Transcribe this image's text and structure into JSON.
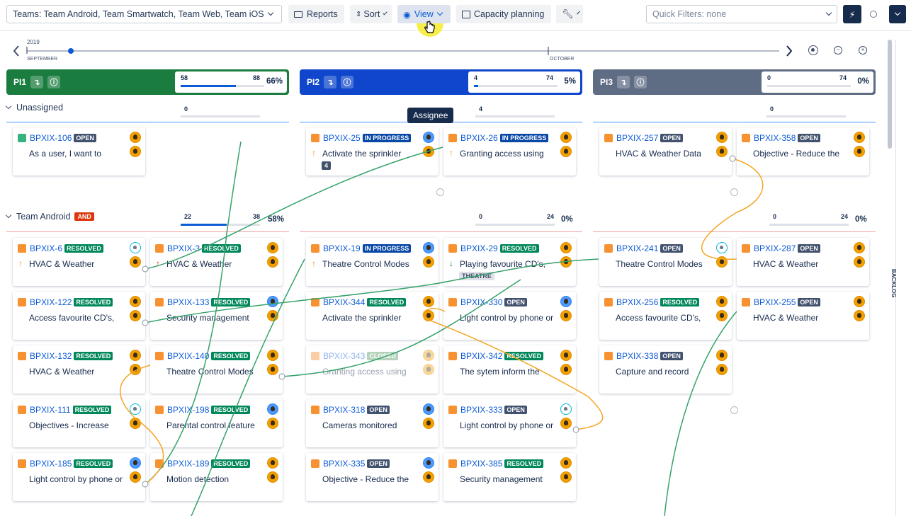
{
  "toolbar": {
    "teams": "Teams: Team Android, Team Smartwatch, Team Web, Team iOS",
    "reports": "Reports",
    "sort": "Sort",
    "view": "View",
    "capacity": "Capacity planning",
    "quick_filters": "Quick Filters: none"
  },
  "timeline": {
    "year": "2019",
    "month1": "SEPTEMBER",
    "month2": "OCTOBER"
  },
  "pis": [
    {
      "name": "PI1",
      "done": "58",
      "total": "88",
      "pct": "66%",
      "fill": 0.66,
      "color": "#1b7c3f",
      "accent": "#0c5bd6"
    },
    {
      "name": "PI2",
      "done": "4",
      "total": "74",
      "pct": "5%",
      "fill": 0.05,
      "color": "#0f46cc",
      "accent": "#0c5bd6"
    },
    {
      "name": "PI3",
      "done": "0",
      "total": "74",
      "pct": "0%",
      "fill": 0,
      "color": "#5e6c84",
      "accent": "#0c5bd6"
    }
  ],
  "lanes": [
    {
      "label": "Unassigned",
      "badge": "",
      "pi1": "0",
      "pi2": "4",
      "pi3": "0"
    },
    {
      "label": "Team Android",
      "badge": "AND",
      "pi1_done": "22",
      "pi1_total": "38",
      "pi1_pct": "58%",
      "pi2_done": "0",
      "pi2_total": "24",
      "pi2_pct": "0%",
      "pi3_done": "0",
      "pi3_total": "24",
      "pi3_pct": "0%"
    }
  ],
  "tooltip": "Assignee",
  "backlog": "BACKLOG",
  "cards": [
    {
      "key": "BPXIX-106",
      "status": "OPEN",
      "title": "As a user, I want to",
      "type": "story"
    },
    {
      "key": "BPXIX-25",
      "status": "IN PROGRESS",
      "title": "Activate the sprinkler",
      "num": "4"
    },
    {
      "key": "BPXIX-26",
      "status": "IN PROGRESS",
      "title": "Granting access using"
    },
    {
      "key": "BPXIX-257",
      "status": "OPEN",
      "title": "HVAC & Weather Data"
    },
    {
      "key": "BPXIX-358",
      "status": "OPEN",
      "title": "Objective - Reduce the"
    },
    {
      "key": "BPXIX-6",
      "status": "RESOLVED",
      "title": "HVAC & Weather"
    },
    {
      "key": "BPXIX-3",
      "status": "RESOLVED",
      "title": "HVAC & Weather"
    },
    {
      "key": "BPXIX-19",
      "status": "IN PROGRESS",
      "title": "Theatre Control Modes"
    },
    {
      "key": "BPXIX-29",
      "status": "RESOLVED",
      "title": "Playing favourite CD's,",
      "chip": "THEATRE"
    },
    {
      "key": "BPXIX-241",
      "status": "OPEN",
      "title": "Theatre Control Modes"
    },
    {
      "key": "BPXIX-287",
      "status": "OPEN",
      "title": "HVAC & Weather"
    },
    {
      "key": "BPXIX-122",
      "status": "RESOLVED",
      "title": "Access favourite CD's,"
    },
    {
      "key": "BPXIX-133",
      "status": "RESOLVED",
      "title": "Security management"
    },
    {
      "key": "BPXIX-344",
      "status": "RESOLVED",
      "title": "Activate the sprinkler"
    },
    {
      "key": "BPXIX-330",
      "status": "OPEN",
      "title": "Light control by phone or"
    },
    {
      "key": "BPXIX-256",
      "status": "RESOLVED",
      "title": "Access favourite CD's,"
    },
    {
      "key": "BPXIX-255",
      "status": "OPEN",
      "title": "HVAC & Weather"
    },
    {
      "key": "BPXIX-132",
      "status": "RESOLVED",
      "title": "HVAC & Weather"
    },
    {
      "key": "BPXIX-140",
      "status": "RESOLVED",
      "title": "Theatre Control Modes"
    },
    {
      "key": "BPXIX-343",
      "status": "CLOSED",
      "title": "Granting access using"
    },
    {
      "key": "BPXIX-342",
      "status": "RESOLVED",
      "title": "The sytem inform the"
    },
    {
      "key": "BPXIX-338",
      "status": "OPEN",
      "title": "Capture and record"
    },
    {
      "key": "BPXIX-111",
      "status": "RESOLVED",
      "title": "Objectives - Increase"
    },
    {
      "key": "BPXIX-198",
      "status": "RESOLVED",
      "title": "Parental control feature"
    },
    {
      "key": "BPXIX-318",
      "status": "OPEN",
      "title": "Cameras monitored"
    },
    {
      "key": "BPXIX-333",
      "status": "OPEN",
      "title": "Light control by phone or"
    },
    {
      "key": "BPXIX-185",
      "status": "RESOLVED",
      "title": "Light control by phone or"
    },
    {
      "key": "BPXIX-189",
      "status": "RESOLVED",
      "title": "Motion detection"
    },
    {
      "key": "BPXIX-335",
      "status": "OPEN",
      "title": "Objective - Reduce the"
    },
    {
      "key": "BPXIX-385",
      "status": "RESOLVED",
      "title": "Security management"
    }
  ]
}
